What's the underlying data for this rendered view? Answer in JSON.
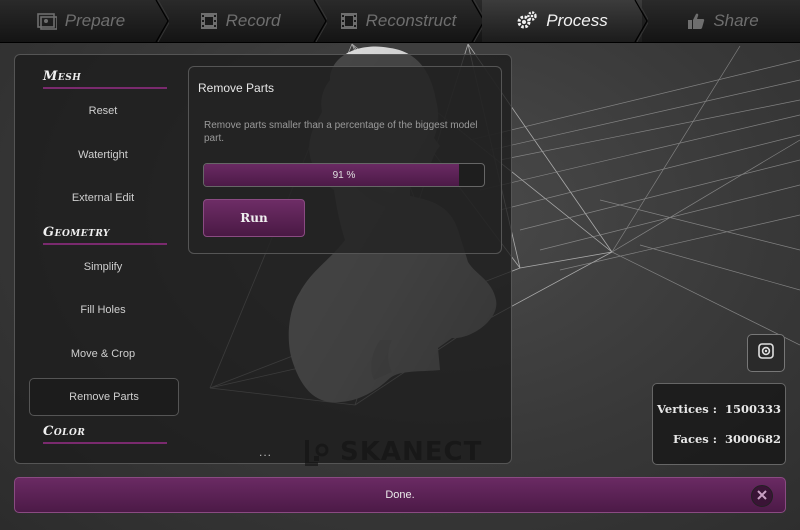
{
  "nav": {
    "steps": [
      {
        "label": "Prepare",
        "icon": "image-icon"
      },
      {
        "label": "Record",
        "icon": "film-icon"
      },
      {
        "label": "Reconstruct",
        "icon": "film-reel-icon"
      },
      {
        "label": "Process",
        "icon": "gears-icon",
        "active": true
      },
      {
        "label": "Share",
        "icon": "thumbs-up-icon"
      }
    ]
  },
  "sidebar": {
    "sections": [
      {
        "title": "Mesh",
        "items": [
          "Reset",
          "Watertight",
          "External Edit"
        ]
      },
      {
        "title": "Geometry",
        "items": [
          "Simplify",
          "Fill Holes",
          "Move & Crop",
          "Remove Parts"
        ]
      },
      {
        "title": "Color",
        "items": []
      }
    ],
    "selected_item": "Remove Parts",
    "more": "..."
  },
  "remove_parts": {
    "title": "Remove Parts",
    "description": "Remove parts smaller than a percentage of the biggest model part.",
    "percent_value": 91,
    "percent_label": "91 %",
    "run_label": "Run"
  },
  "stats": {
    "vertices_label": "Vertices :",
    "vertices_value": "1500333",
    "faces_label": "Faces :",
    "faces_value": "3000682"
  },
  "watermark": "SKANECT",
  "status": {
    "message": "Done."
  },
  "colors": {
    "accent": "#6a2a63",
    "active_text": "#f2f2f2",
    "inactive_text": "#6e6e6e"
  }
}
